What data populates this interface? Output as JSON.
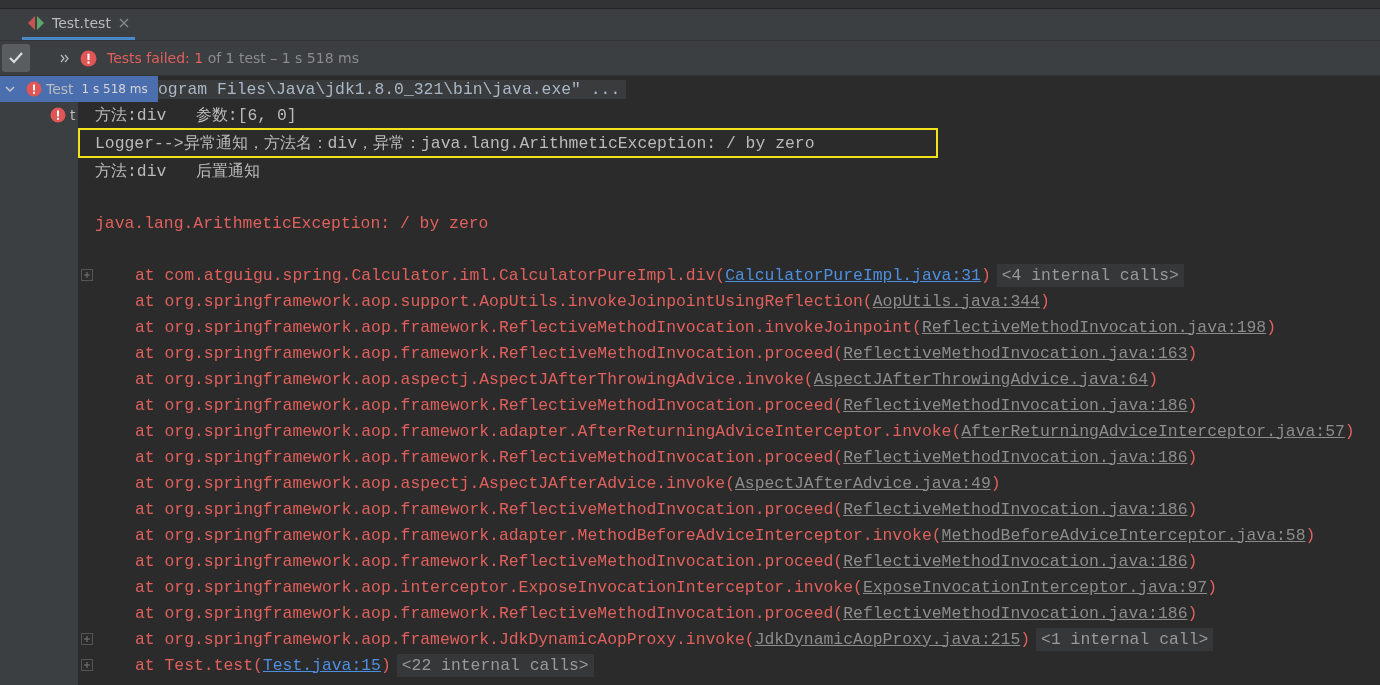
{
  "tab": {
    "label": "Test.test",
    "selected": true
  },
  "status": {
    "failed": "Tests failed: 1",
    "rest": "of 1 test – 1 s 518 ms"
  },
  "tree": [
    {
      "name": "Test",
      "time": "1 s 518 ms",
      "selected": true,
      "expanded": true,
      "kind": "failed"
    },
    {
      "name": "t",
      "selected": false,
      "kind": "failed"
    }
  ],
  "console": {
    "command": "ogram Files\\Java\\jdk1.8.0_321\\bin\\java.exe\" ...",
    "lines": [
      {
        "kind": "out",
        "text": "方法:div   参数:[6, 0]"
      },
      {
        "kind": "highlighted",
        "text": "Logger-->异常通知，方法名：div，异常：java.lang.ArithmeticException: / by zero"
      },
      {
        "kind": "out",
        "text": "方法:div   后置通知"
      },
      {
        "kind": "blank"
      },
      {
        "kind": "error",
        "text": "java.lang.ArithmeticException: / by zero"
      },
      {
        "kind": "blank"
      }
    ],
    "frames": [
      {
        "foldable": true,
        "text": "at com.atguigu.spring.Calculator.iml.CalculatorPureImpl.div(",
        "link": "CalculatorPureImpl.java:31",
        "kind": "project",
        "close": ")",
        "internal": "<4 internal calls>"
      },
      {
        "foldable": false,
        "text": "at org.springframework.aop.support.AopUtils.invokeJoinpointUsingReflection(",
        "link": "AopUtils.java:344",
        "kind": "library",
        "close": ")"
      },
      {
        "foldable": false,
        "text": "at org.springframework.aop.framework.ReflectiveMethodInvocation.invokeJoinpoint(",
        "link": "ReflectiveMethodInvocation.java:198",
        "kind": "library",
        "close": ")"
      },
      {
        "foldable": false,
        "text": "at org.springframework.aop.framework.ReflectiveMethodInvocation.proceed(",
        "link": "ReflectiveMethodInvocation.java:163",
        "kind": "library",
        "close": ")"
      },
      {
        "foldable": false,
        "text": "at org.springframework.aop.aspectj.AspectJAfterThrowingAdvice.invoke(",
        "link": "AspectJAfterThrowingAdvice.java:64",
        "kind": "library",
        "close": ")"
      },
      {
        "foldable": false,
        "text": "at org.springframework.aop.framework.ReflectiveMethodInvocation.proceed(",
        "link": "ReflectiveMethodInvocation.java:186",
        "kind": "library",
        "close": ")"
      },
      {
        "foldable": false,
        "text": "at org.springframework.aop.framework.adapter.AfterReturningAdviceInterceptor.invoke(",
        "link": "AfterReturningAdviceInterceptor.java:57",
        "kind": "library",
        "close": ")"
      },
      {
        "foldable": false,
        "text": "at org.springframework.aop.framework.ReflectiveMethodInvocation.proceed(",
        "link": "ReflectiveMethodInvocation.java:186",
        "kind": "library",
        "close": ")"
      },
      {
        "foldable": false,
        "text": "at org.springframework.aop.aspectj.AspectJAfterAdvice.invoke(",
        "link": "AspectJAfterAdvice.java:49",
        "kind": "library",
        "close": ")"
      },
      {
        "foldable": false,
        "text": "at org.springframework.aop.framework.ReflectiveMethodInvocation.proceed(",
        "link": "ReflectiveMethodInvocation.java:186",
        "kind": "library",
        "close": ")"
      },
      {
        "foldable": false,
        "text": "at org.springframework.aop.framework.adapter.MethodBeforeAdviceInterceptor.invoke(",
        "link": "MethodBeforeAdviceInterceptor.java:58",
        "kind": "library",
        "close": ")"
      },
      {
        "foldable": false,
        "text": "at org.springframework.aop.framework.ReflectiveMethodInvocation.proceed(",
        "link": "ReflectiveMethodInvocation.java:186",
        "kind": "library",
        "close": ")"
      },
      {
        "foldable": false,
        "text": "at org.springframework.aop.interceptor.ExposeInvocationInterceptor.invoke(",
        "link": "ExposeInvocationInterceptor.java:97",
        "kind": "library",
        "close": ")"
      },
      {
        "foldable": false,
        "text": "at org.springframework.aop.framework.ReflectiveMethodInvocation.proceed(",
        "link": "ReflectiveMethodInvocation.java:186",
        "kind": "library",
        "close": ")"
      },
      {
        "foldable": true,
        "text": "at org.springframework.aop.framework.JdkDynamicAopProxy.invoke(",
        "link": "JdkDynamicAopProxy.java:215",
        "kind": "library",
        "close": ")",
        "internal": "<1 internal call>"
      },
      {
        "foldable": true,
        "text": "at Test.test(",
        "link": "Test.java:15",
        "kind": "project",
        "close": ")",
        "internal": "<22 internal calls>"
      }
    ]
  }
}
